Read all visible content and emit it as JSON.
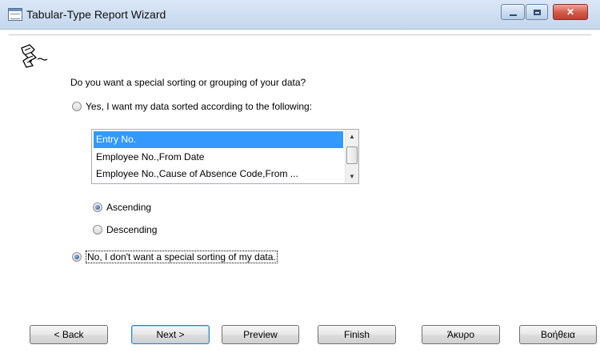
{
  "window": {
    "title": "Tabular-Type Report Wizard",
    "controls": {
      "minimize": "",
      "maximize": "",
      "close": "✕"
    }
  },
  "wizard": {
    "icon": "wizard-hand-paper-icon",
    "question": "Do you want a special sorting or grouping of your data?",
    "option_yes": "Yes, I want my data sorted according to the following:",
    "option_no": "No, I don't want a special sorting of my data.",
    "selected_option": "no",
    "sort_keys": [
      "Entry No.",
      "Employee No.,From Date",
      "Employee No.,Cause of Absence Code,From ..."
    ],
    "selected_key_index": 0,
    "order_ascending": "Ascending",
    "order_descending": "Descending",
    "selected_order": "ascending"
  },
  "buttons": {
    "back": "< Back",
    "next": "Next >",
    "preview": "Preview",
    "finish": "Finish",
    "cancel": "Άκυρο",
    "help": "Βοήθεια"
  },
  "colors": {
    "selection": "#3399ff",
    "titlebar": "#c4d7ee",
    "close_button": "#c43e2d"
  }
}
